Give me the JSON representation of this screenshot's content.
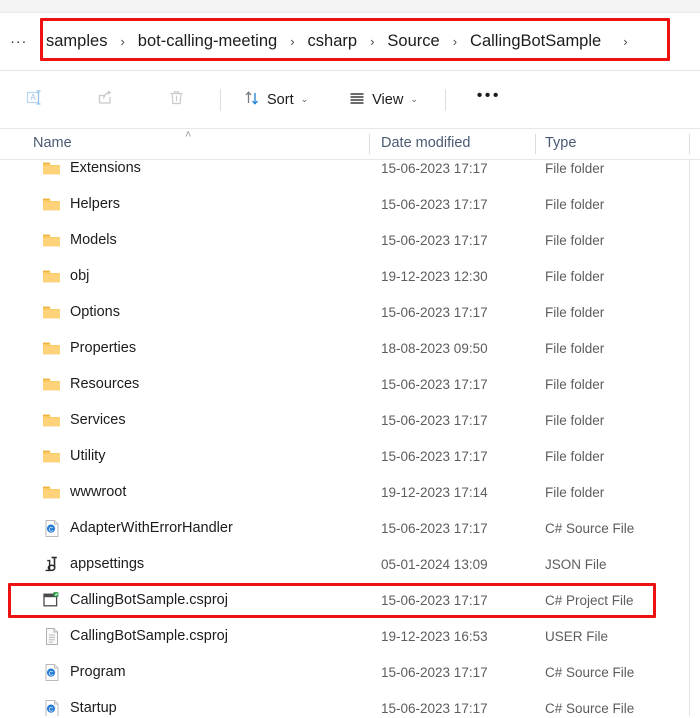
{
  "address_bar": {
    "overflow_label": "...",
    "separator": "›",
    "crumbs": [
      "samples",
      "bot-calling-meeting",
      "csharp",
      "Source",
      "CallingBotSample"
    ],
    "trailing_separator": "›"
  },
  "command_bar": {
    "rename_icon": "rename-icon",
    "share_icon": "share-icon",
    "delete_icon": "delete-icon",
    "sort_label": "Sort",
    "sort_icon": "sort-arrows-icon",
    "view_label": "View",
    "view_icon": "view-lines-icon",
    "overflow_label": "•••",
    "chevron": "⌄"
  },
  "columns": {
    "name": "Name",
    "date_modified": "Date modified",
    "type": "Type",
    "sort_indicator": "˄"
  },
  "files": [
    {
      "name": "Extensions",
      "date": "15-06-2023 17:17",
      "type": "File folder",
      "icon": "folder-icon"
    },
    {
      "name": "Helpers",
      "date": "15-06-2023 17:17",
      "type": "File folder",
      "icon": "folder-icon"
    },
    {
      "name": "Models",
      "date": "15-06-2023 17:17",
      "type": "File folder",
      "icon": "folder-icon"
    },
    {
      "name": "obj",
      "date": "19-12-2023 12:30",
      "type": "File folder",
      "icon": "folder-icon"
    },
    {
      "name": "Options",
      "date": "15-06-2023 17:17",
      "type": "File folder",
      "icon": "folder-icon"
    },
    {
      "name": "Properties",
      "date": "18-08-2023 09:50",
      "type": "File folder",
      "icon": "folder-icon"
    },
    {
      "name": "Resources",
      "date": "15-06-2023 17:17",
      "type": "File folder",
      "icon": "folder-icon"
    },
    {
      "name": "Services",
      "date": "15-06-2023 17:17",
      "type": "File folder",
      "icon": "folder-icon"
    },
    {
      "name": "Utility",
      "date": "15-06-2023 17:17",
      "type": "File folder",
      "icon": "folder-icon"
    },
    {
      "name": "wwwroot",
      "date": "19-12-2023 17:14",
      "type": "File folder",
      "icon": "folder-icon"
    },
    {
      "name": "AdapterWithErrorHandler",
      "date": "15-06-2023 17:17",
      "type": "C# Source File",
      "icon": "csharp-source-icon"
    },
    {
      "name": "appsettings",
      "date": "05-01-2024 13:09",
      "type": "JSON File",
      "icon": "json-file-icon"
    },
    {
      "name": "CallingBotSample.csproj",
      "date": "15-06-2023 17:17",
      "type": "C# Project File",
      "icon": "csharp-project-icon"
    },
    {
      "name": "CallingBotSample.csproj",
      "date": "19-12-2023 16:53",
      "type": "USER File",
      "icon": "generic-document-icon"
    },
    {
      "name": "Program",
      "date": "15-06-2023 17:17",
      "type": "C# Source File",
      "icon": "csharp-source-icon"
    },
    {
      "name": "Startup",
      "date": "15-06-2023 17:17",
      "type": "C# Source File",
      "icon": "csharp-source-icon"
    }
  ],
  "annotations": {
    "highlight_color": "#ee1111",
    "breadcrumb_box": "address-bar",
    "row_box_index": 12
  },
  "colors": {
    "folder": "#fcc75a",
    "csharp_accent": "#2a7fd4",
    "header_text": "#4a5a73",
    "accent": "#0067c0"
  }
}
